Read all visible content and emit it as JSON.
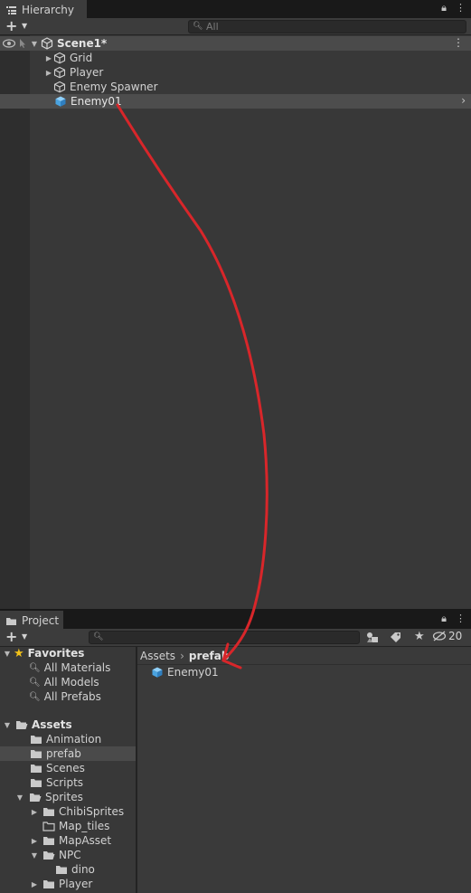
{
  "hierarchy": {
    "tab_title": "Hierarchy",
    "search_placeholder": "All",
    "scene_name": "Scene1*",
    "items": [
      {
        "label": "Grid",
        "expandable": true
      },
      {
        "label": "Player",
        "expandable": true
      },
      {
        "label": "Enemy Spawner",
        "expandable": false
      },
      {
        "label": "Enemy01",
        "expandable": false,
        "prefab": true,
        "selected": true
      }
    ]
  },
  "project": {
    "tab_title": "Project",
    "hidden_count": "20",
    "breadcrumb": {
      "root": "Assets",
      "current": "prefab"
    },
    "favorites": {
      "label": "Favorites",
      "items": [
        "All Materials",
        "All Models",
        "All Prefabs"
      ]
    },
    "assets": {
      "label": "Assets",
      "folders": [
        "Animation",
        "prefab",
        "Scenes",
        "Scripts",
        "Sprites"
      ],
      "sprites_children": [
        "ChibiSprites",
        "Map_tiles",
        "MapAsset",
        "NPC",
        "Player"
      ],
      "npc_children": [
        "dino"
      ]
    },
    "content_items": [
      "Enemy01"
    ]
  },
  "colors": {
    "annotation": "#d8262a",
    "prefab_blue": "#5fb4f0",
    "star": "#f2c21a"
  }
}
